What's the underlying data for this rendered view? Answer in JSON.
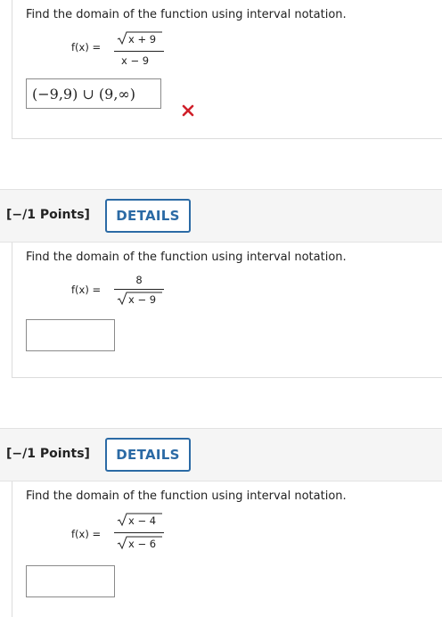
{
  "colors": {
    "accent": "#2b6aa5",
    "incorrect": "#d0202a"
  },
  "questions": [
    {
      "prompt": "Find the domain of the function using interval notation.",
      "fx_label": "f(x) =",
      "numerator": "x + 9",
      "numerator_is_radical": true,
      "denominator": "x − 9",
      "denominator_is_radical": false,
      "answer_value": "(−9,9) ∪ (9,∞)",
      "status": "incorrect",
      "status_icon": "x-icon"
    },
    {
      "points_label": "[−/1 Points]",
      "details_label": "DETAILS",
      "prompt": "Find the domain of the function using interval notation.",
      "fx_label": "f(x) =",
      "numerator": "8",
      "numerator_is_radical": false,
      "denominator": "x − 9",
      "denominator_is_radical": true,
      "answer_value": ""
    },
    {
      "points_label": "[−/1 Points]",
      "details_label": "DETAILS",
      "prompt": "Find the domain of the function using interval notation.",
      "fx_label": "f(x) =",
      "numerator": "x − 4",
      "numerator_is_radical": true,
      "denominator": "x − 6",
      "denominator_is_radical": true,
      "answer_value": ""
    }
  ]
}
